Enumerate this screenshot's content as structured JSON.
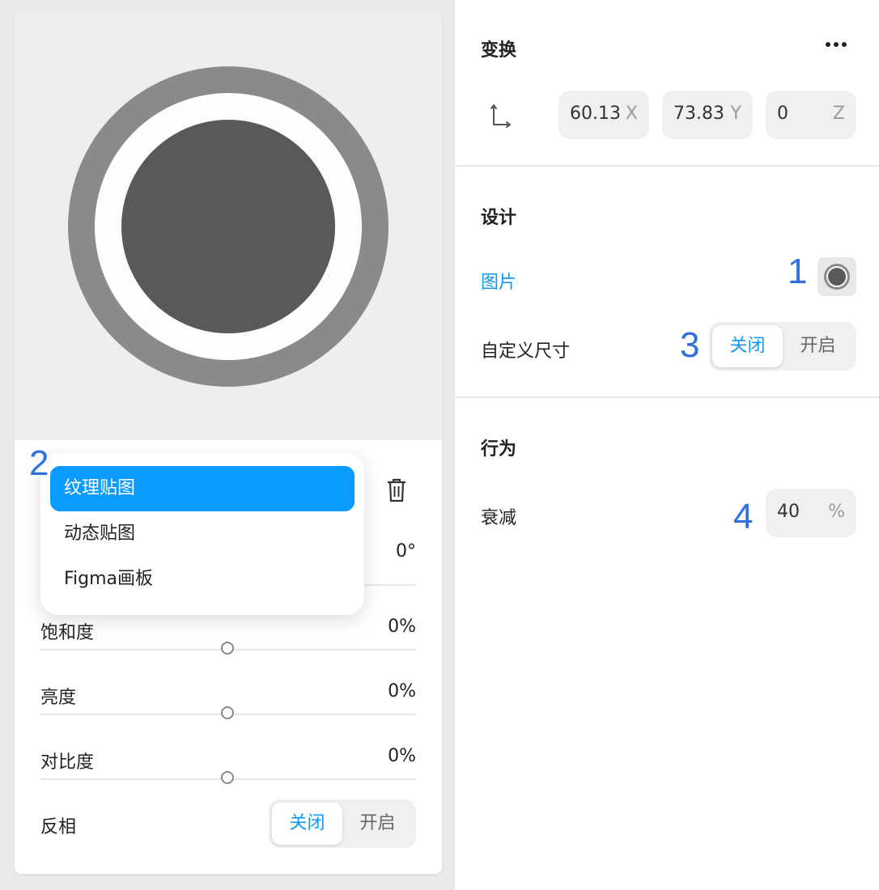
{
  "left_panel": {
    "hue_value": "0°",
    "dropdown": {
      "items": [
        {
          "label": "纹理贴图",
          "selected": true
        },
        {
          "label": "动态贴图",
          "selected": false
        },
        {
          "label": "Figma画板",
          "selected": false
        }
      ]
    },
    "adjustments": [
      {
        "label": "饱和度",
        "value": "0%"
      },
      {
        "label": "亮度",
        "value": "0%"
      },
      {
        "label": "对比度",
        "value": "0%"
      }
    ],
    "invert": {
      "label": "反相",
      "options": [
        "关闭",
        "开启"
      ],
      "selected": "关闭"
    }
  },
  "inspector": {
    "transform": {
      "title": "变换",
      "x": {
        "value": "60.13",
        "axis": "X"
      },
      "y": {
        "value": "73.83",
        "axis": "Y"
      },
      "z": {
        "value": "0",
        "axis": "Z"
      }
    },
    "design": {
      "title": "设计",
      "image_label": "图片",
      "custom_size_label": "自定义尺寸",
      "custom_size_options": [
        "关闭",
        "开启"
      ],
      "custom_size_selected": "关闭"
    },
    "behavior": {
      "title": "行为",
      "decay_label": "衰减",
      "decay_value": "40",
      "decay_unit": "%"
    }
  },
  "markers": {
    "m1": "1",
    "m2": "2",
    "m3": "3",
    "m4": "4"
  },
  "colors": {
    "accent": "#1296f2",
    "selected_item": "#0b9bff",
    "marker": "#2f6fe0"
  },
  "icons": [
    "trash-icon",
    "more-icon",
    "axes-icon"
  ]
}
